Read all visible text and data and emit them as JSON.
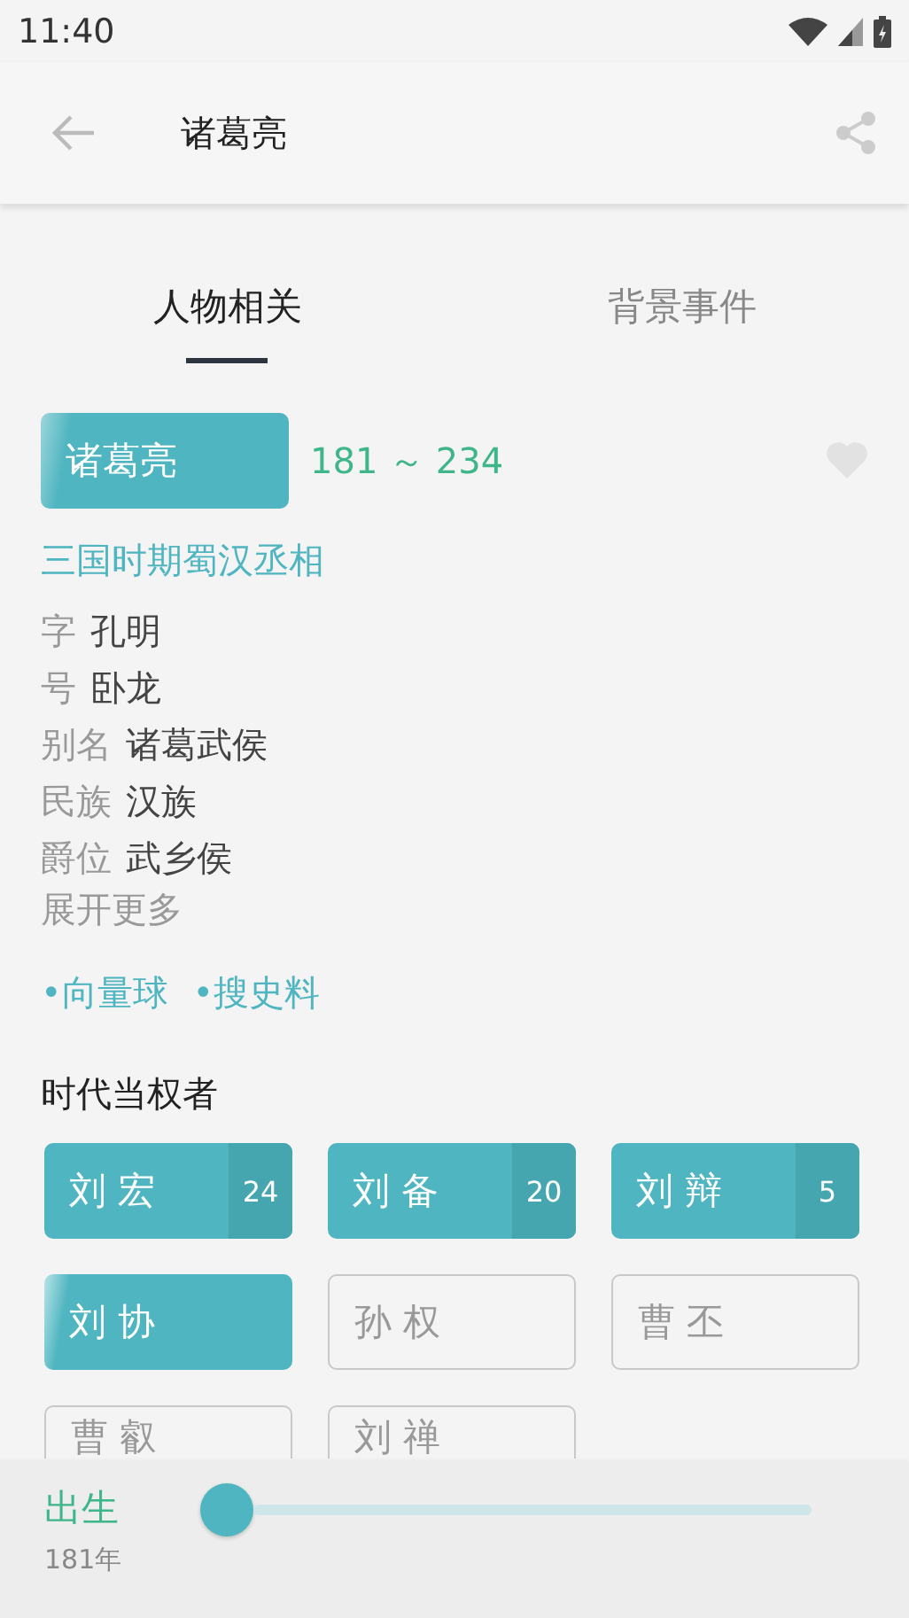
{
  "status_bar": {
    "time": "11:40"
  },
  "toolbar": {
    "title": "诸葛亮"
  },
  "tabs": [
    {
      "label": "人物相关",
      "selected": true
    },
    {
      "label": "背景事件",
      "selected": false
    }
  ],
  "person": {
    "name": "诸葛亮",
    "years": "181 ～ 234",
    "favorite": false,
    "summary": "三国时期蜀汉丞相",
    "facts": [
      {
        "label": "字",
        "value": "孔明"
      },
      {
        "label": "号",
        "value": "卧龙"
      },
      {
        "label": "别名",
        "value": "诸葛武侯"
      },
      {
        "label": "民族",
        "value": "汉族"
      },
      {
        "label": "爵位",
        "value": "武乡侯"
      }
    ],
    "expand": "展开更多",
    "links": [
      "•向量球",
      "•搜史料"
    ]
  },
  "rulers_section": {
    "title": "时代当权者",
    "rulers": [
      {
        "name": "刘 宏",
        "count": "24",
        "selected": true
      },
      {
        "name": "刘 备",
        "count": "20",
        "selected": true
      },
      {
        "name": "刘 辩",
        "count": "5",
        "selected": true
      },
      {
        "name": "刘 协",
        "selected": true
      },
      {
        "name": "孙 权",
        "selected": false
      },
      {
        "name": "曹 丕",
        "selected": false
      },
      {
        "name": "曹 叡",
        "selected": false
      },
      {
        "name": "刘 禅",
        "selected": false
      }
    ]
  },
  "timeline": {
    "label": "出生",
    "year": "181年",
    "level": 0
  }
}
